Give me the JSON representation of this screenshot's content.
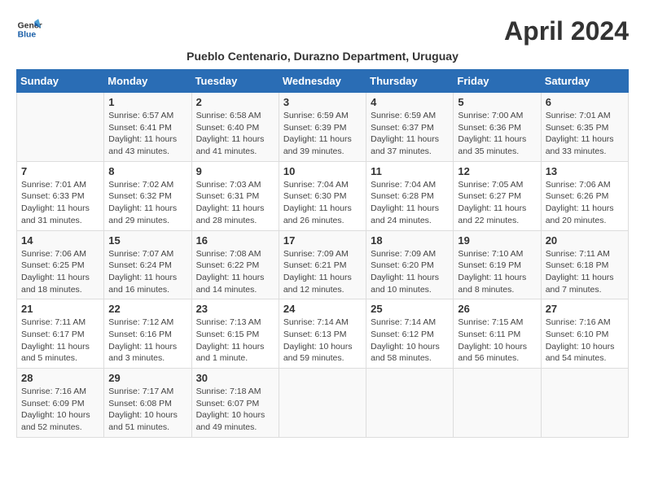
{
  "logo": {
    "line1": "General",
    "line2": "Blue"
  },
  "title": "April 2024",
  "subtitle": "Pueblo Centenario, Durazno Department, Uruguay",
  "days_of_week": [
    "Sunday",
    "Monday",
    "Tuesday",
    "Wednesday",
    "Thursday",
    "Friday",
    "Saturday"
  ],
  "weeks": [
    [
      {
        "day": "",
        "info": ""
      },
      {
        "day": "1",
        "info": "Sunrise: 6:57 AM\nSunset: 6:41 PM\nDaylight: 11 hours\nand 43 minutes."
      },
      {
        "day": "2",
        "info": "Sunrise: 6:58 AM\nSunset: 6:40 PM\nDaylight: 11 hours\nand 41 minutes."
      },
      {
        "day": "3",
        "info": "Sunrise: 6:59 AM\nSunset: 6:39 PM\nDaylight: 11 hours\nand 39 minutes."
      },
      {
        "day": "4",
        "info": "Sunrise: 6:59 AM\nSunset: 6:37 PM\nDaylight: 11 hours\nand 37 minutes."
      },
      {
        "day": "5",
        "info": "Sunrise: 7:00 AM\nSunset: 6:36 PM\nDaylight: 11 hours\nand 35 minutes."
      },
      {
        "day": "6",
        "info": "Sunrise: 7:01 AM\nSunset: 6:35 PM\nDaylight: 11 hours\nand 33 minutes."
      }
    ],
    [
      {
        "day": "7",
        "info": "Sunrise: 7:01 AM\nSunset: 6:33 PM\nDaylight: 11 hours\nand 31 minutes."
      },
      {
        "day": "8",
        "info": "Sunrise: 7:02 AM\nSunset: 6:32 PM\nDaylight: 11 hours\nand 29 minutes."
      },
      {
        "day": "9",
        "info": "Sunrise: 7:03 AM\nSunset: 6:31 PM\nDaylight: 11 hours\nand 28 minutes."
      },
      {
        "day": "10",
        "info": "Sunrise: 7:04 AM\nSunset: 6:30 PM\nDaylight: 11 hours\nand 26 minutes."
      },
      {
        "day": "11",
        "info": "Sunrise: 7:04 AM\nSunset: 6:28 PM\nDaylight: 11 hours\nand 24 minutes."
      },
      {
        "day": "12",
        "info": "Sunrise: 7:05 AM\nSunset: 6:27 PM\nDaylight: 11 hours\nand 22 minutes."
      },
      {
        "day": "13",
        "info": "Sunrise: 7:06 AM\nSunset: 6:26 PM\nDaylight: 11 hours\nand 20 minutes."
      }
    ],
    [
      {
        "day": "14",
        "info": "Sunrise: 7:06 AM\nSunset: 6:25 PM\nDaylight: 11 hours\nand 18 minutes."
      },
      {
        "day": "15",
        "info": "Sunrise: 7:07 AM\nSunset: 6:24 PM\nDaylight: 11 hours\nand 16 minutes."
      },
      {
        "day": "16",
        "info": "Sunrise: 7:08 AM\nSunset: 6:22 PM\nDaylight: 11 hours\nand 14 minutes."
      },
      {
        "day": "17",
        "info": "Sunrise: 7:09 AM\nSunset: 6:21 PM\nDaylight: 11 hours\nand 12 minutes."
      },
      {
        "day": "18",
        "info": "Sunrise: 7:09 AM\nSunset: 6:20 PM\nDaylight: 11 hours\nand 10 minutes."
      },
      {
        "day": "19",
        "info": "Sunrise: 7:10 AM\nSunset: 6:19 PM\nDaylight: 11 hours\nand 8 minutes."
      },
      {
        "day": "20",
        "info": "Sunrise: 7:11 AM\nSunset: 6:18 PM\nDaylight: 11 hours\nand 7 minutes."
      }
    ],
    [
      {
        "day": "21",
        "info": "Sunrise: 7:11 AM\nSunset: 6:17 PM\nDaylight: 11 hours\nand 5 minutes."
      },
      {
        "day": "22",
        "info": "Sunrise: 7:12 AM\nSunset: 6:16 PM\nDaylight: 11 hours\nand 3 minutes."
      },
      {
        "day": "23",
        "info": "Sunrise: 7:13 AM\nSunset: 6:15 PM\nDaylight: 11 hours\nand 1 minute."
      },
      {
        "day": "24",
        "info": "Sunrise: 7:14 AM\nSunset: 6:13 PM\nDaylight: 10 hours\nand 59 minutes."
      },
      {
        "day": "25",
        "info": "Sunrise: 7:14 AM\nSunset: 6:12 PM\nDaylight: 10 hours\nand 58 minutes."
      },
      {
        "day": "26",
        "info": "Sunrise: 7:15 AM\nSunset: 6:11 PM\nDaylight: 10 hours\nand 56 minutes."
      },
      {
        "day": "27",
        "info": "Sunrise: 7:16 AM\nSunset: 6:10 PM\nDaylight: 10 hours\nand 54 minutes."
      }
    ],
    [
      {
        "day": "28",
        "info": "Sunrise: 7:16 AM\nSunset: 6:09 PM\nDaylight: 10 hours\nand 52 minutes."
      },
      {
        "day": "29",
        "info": "Sunrise: 7:17 AM\nSunset: 6:08 PM\nDaylight: 10 hours\nand 51 minutes."
      },
      {
        "day": "30",
        "info": "Sunrise: 7:18 AM\nSunset: 6:07 PM\nDaylight: 10 hours\nand 49 minutes."
      },
      {
        "day": "",
        "info": ""
      },
      {
        "day": "",
        "info": ""
      },
      {
        "day": "",
        "info": ""
      },
      {
        "day": "",
        "info": ""
      }
    ]
  ]
}
